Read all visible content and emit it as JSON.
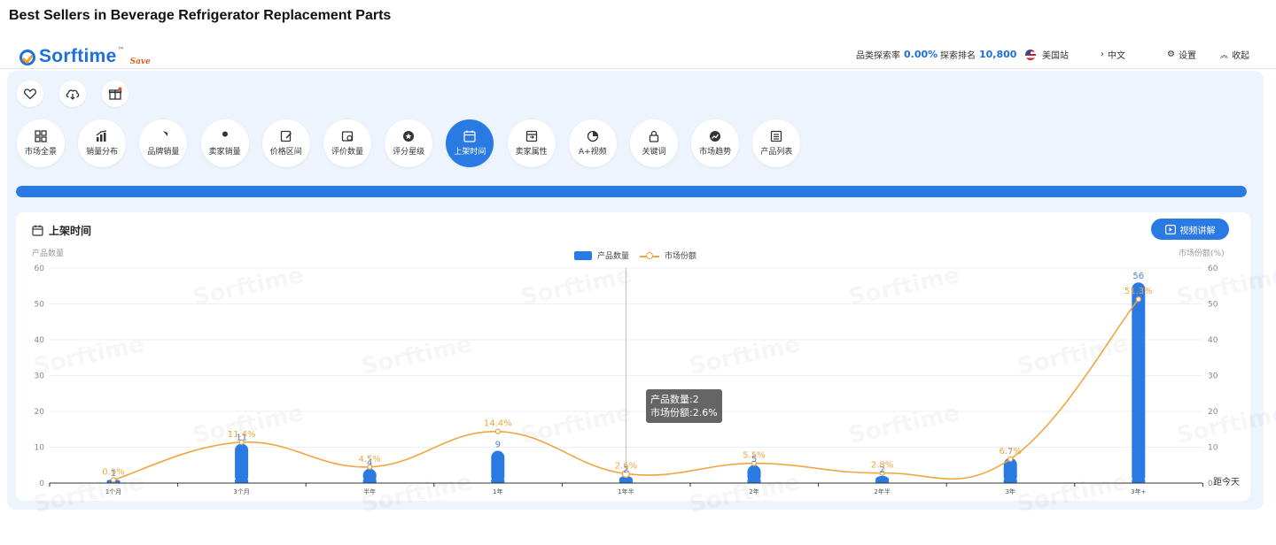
{
  "page_title": "Best Sellers in Beverage Refrigerator Replacement Parts",
  "logo": {
    "text": "Sorftime",
    "tm": "™",
    "save": "Save"
  },
  "topbar": {
    "category_rate_label": "品类探索率",
    "category_rate_value": "0.00%",
    "rank_label": "探索排名",
    "rank_value": "10,800",
    "site_label": "美国站",
    "lang_label": "中文",
    "settings_label": "设置",
    "collapse_label": "收起"
  },
  "tabs": [
    {
      "label": "市场全景",
      "icon": "grid-icon"
    },
    {
      "label": "销量分布",
      "icon": "bar-chart-icon"
    },
    {
      "label": "品牌销量",
      "icon": "shield-icon"
    },
    {
      "label": "卖家销量",
      "icon": "user-icon"
    },
    {
      "label": "价格区间",
      "icon": "price-edit-icon"
    },
    {
      "label": "评价数量",
      "icon": "review-icon"
    },
    {
      "label": "评分星级",
      "icon": "star-icon"
    },
    {
      "label": "上架时间",
      "icon": "calendar-icon",
      "active": true
    },
    {
      "label": "卖家属性",
      "icon": "store-icon"
    },
    {
      "label": "A+视频",
      "icon": "pie-icon"
    },
    {
      "label": "关键词",
      "icon": "lock-icon"
    },
    {
      "label": "市场趋势",
      "icon": "trend-icon"
    },
    {
      "label": "产品列表",
      "icon": "list-icon"
    }
  ],
  "progress": {
    "value": 1.0
  },
  "card": {
    "title": "上架时间",
    "video_button": "视频讲解"
  },
  "tooltip": {
    "line1": "产品数量:2",
    "line2": "市场份额:2.6%"
  },
  "watermark": "Sorftime",
  "colors": {
    "accent": "#2a7ae4",
    "line": "#f0a540",
    "panel_bg": "#eef4fe"
  },
  "chart_data": {
    "type": "bar",
    "categories": [
      "1个月",
      "3个月",
      "半年",
      "1年",
      "1年半",
      "2年",
      "2年半",
      "3年",
      "3年+"
    ],
    "series": [
      {
        "name": "产品数量",
        "type": "bar",
        "axis": "left",
        "values": [
          1,
          11,
          4,
          9,
          2,
          5,
          2,
          7,
          56
        ]
      },
      {
        "name": "市场份额",
        "type": "line",
        "axis": "right",
        "values": [
          0.9,
          11.4,
          4.5,
          14.4,
          2.6,
          5.5,
          2.8,
          6.7,
          51.3
        ],
        "labels": [
          "0.9%",
          "11.4%",
          "4.5%",
          "14.4%",
          "2.6%",
          "5.5%",
          "2.8%",
          "6.7%",
          "51.3%"
        ]
      }
    ],
    "ylabel_left": "产品数量",
    "ylabel_right": "市场份额(%)",
    "x_unit": "距今天",
    "ylim": [
      0,
      60
    ],
    "yticks": [
      0,
      10,
      20,
      30,
      40,
      50,
      60
    ],
    "hover_category": "1年半",
    "legend": "top-center",
    "grid": true
  }
}
